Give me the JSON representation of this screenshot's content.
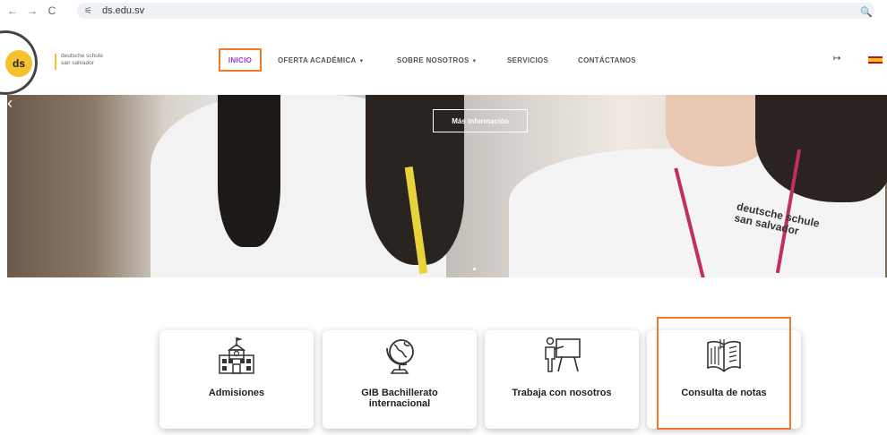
{
  "browser": {
    "url": "ds.edu.sv",
    "back_icon": "←",
    "forward_icon": "→",
    "reload_icon": "C",
    "tune_icon": "⚟",
    "zoom_icon": "🔍"
  },
  "header": {
    "logo_mark": "ds",
    "logo_line1": "deutsche schule",
    "logo_line2": "san salvador",
    "nav": {
      "inicio": "INICIO",
      "oferta": "OFERTA ACADÉMICA",
      "sobre": "SOBRE NOSOTROS",
      "servicios": "SERVICIOS",
      "contactanos": "CONTÁCTANOS",
      "caret": "▾"
    },
    "login_icon": "↦"
  },
  "hero": {
    "cta_label": "Más información",
    "prev_arrow": "‹",
    "shirt_line1": "deutsche schule",
    "shirt_line2": "san salvador"
  },
  "cards": {
    "admisiones": "Admisiones",
    "gib_line1": "GIB Bachillerato",
    "gib_line2": "internacional",
    "trabaja": "Trabaja con nosotros",
    "consulta": "Consulta de notas"
  },
  "colors": {
    "highlight": "#f07b2a",
    "active_nav": "#9a3bd0",
    "logo_yellow": "#f3c22e"
  }
}
